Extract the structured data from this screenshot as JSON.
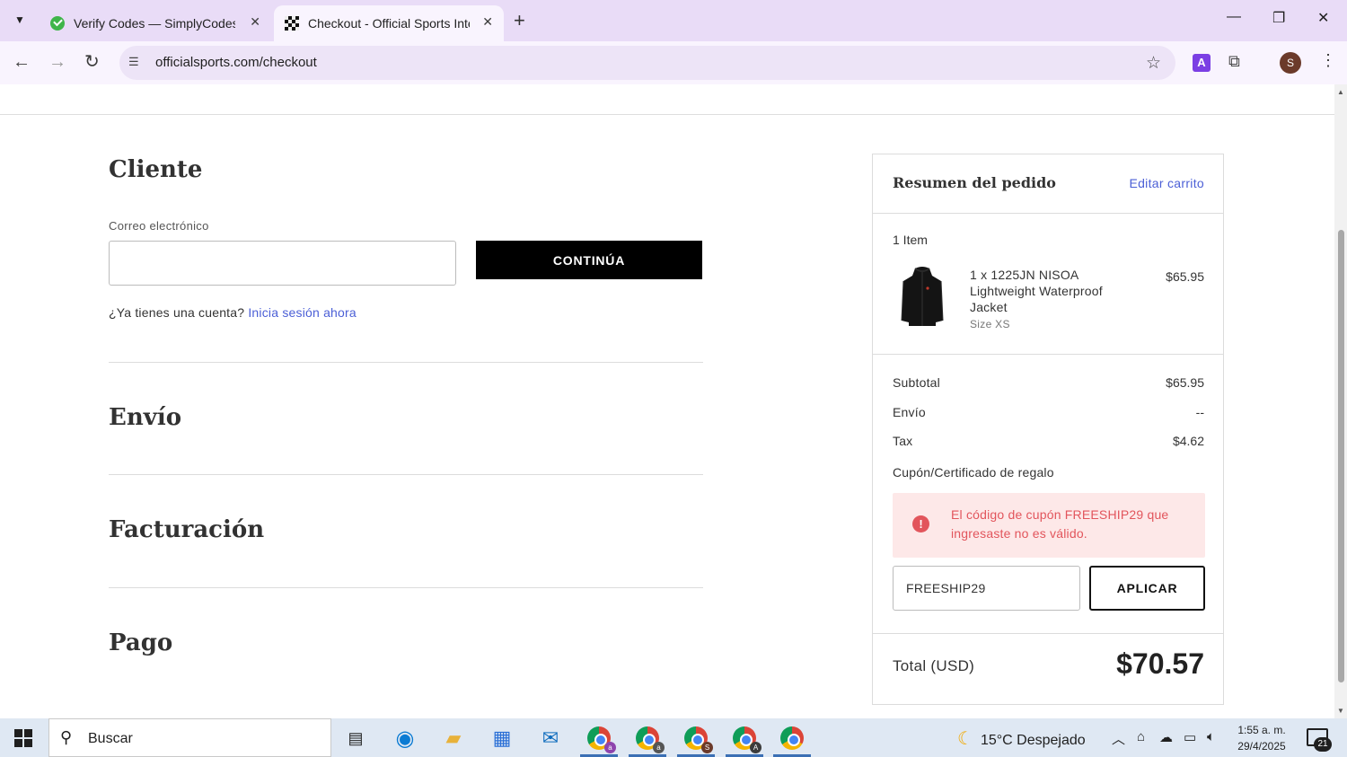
{
  "browser": {
    "tabs": [
      {
        "title": "Verify Codes — SimplyCodes",
        "active": false
      },
      {
        "title": "Checkout - Official Sports Intern",
        "active": true
      }
    ],
    "url": "officialsports.com/checkout",
    "profile_initial": "S",
    "extension_label": "A"
  },
  "checkout": {
    "customer": {
      "heading": "Cliente",
      "email_label": "Correo electrónico",
      "email_value": "",
      "continue_label": "CONTINÚA",
      "account_prompt": "¿Ya tienes una cuenta?",
      "signin_link": "Inicia sesión ahora"
    },
    "shipping_heading": "Envío",
    "billing_heading": "Facturación",
    "payment_heading": "Pago"
  },
  "summary": {
    "title": "Resumen del pedido",
    "edit_cart": "Editar carrito",
    "items_count": "1 Item",
    "item": {
      "name": "1 x 1225JN NISOA Lightweight Waterproof Jacket",
      "size": "Size XS",
      "price": "$65.95"
    },
    "subtotal_label": "Subtotal",
    "subtotal_value": "$65.95",
    "shipping_label": "Envío",
    "shipping_value": "--",
    "tax_label": "Tax",
    "tax_value": "$4.62",
    "coupon_label": "Cupón/Certificado de regalo",
    "error_message": "El código de cupón FREESHIP29 que ingresaste no es válido.",
    "coupon_value": "FREESHIP29",
    "apply_label": "APLICAR",
    "total_label": "Total (USD)",
    "total_value": "$70.57"
  },
  "taskbar": {
    "search_placeholder": "Buscar",
    "weather": "15°C  Despejado",
    "time": "1:55 a. m.",
    "date": "29/4/2025",
    "notification_count": "21",
    "chrome_badges": [
      "a",
      "a",
      "S",
      "A",
      ""
    ]
  },
  "colors": {
    "accent_link": "#4b5fd6",
    "error_text": "#e2555c",
    "error_bg": "#fde8e8",
    "tabbar_bg": "#e9dcf7"
  }
}
